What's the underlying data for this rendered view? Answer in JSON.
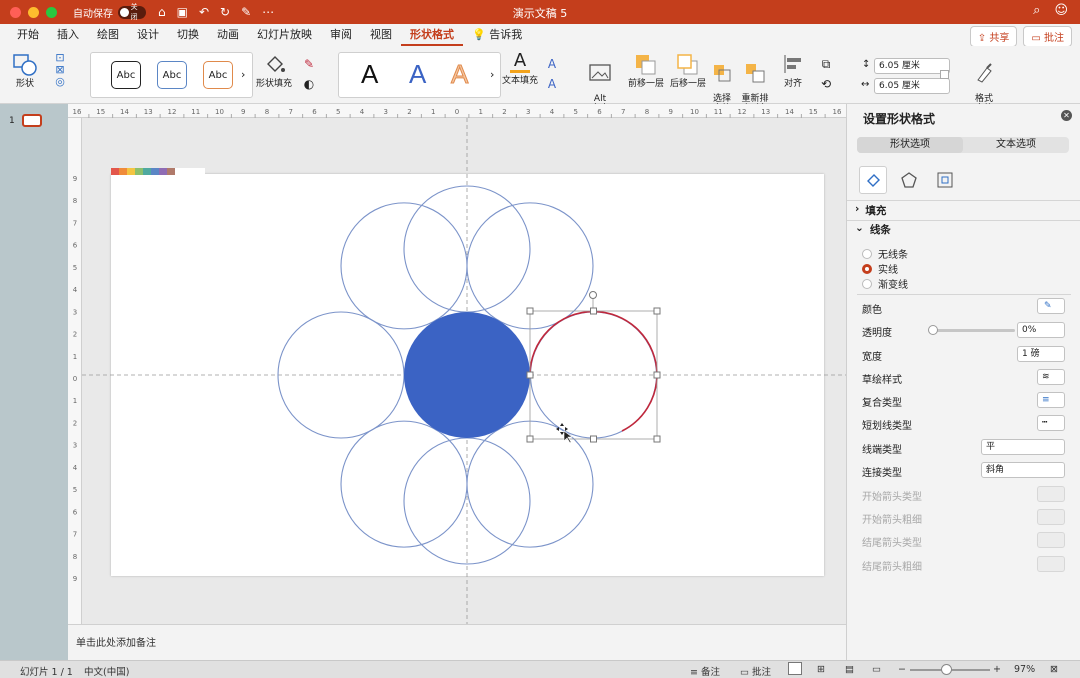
{
  "app": {
    "doc_title": "演示文稿 5",
    "autosave_label": "自动保存",
    "autosave_state": "关闭",
    "titlebar_color": "#c43e1c"
  },
  "tabs": [
    {
      "label": "开始"
    },
    {
      "label": "插入"
    },
    {
      "label": "绘图"
    },
    {
      "label": "设计"
    },
    {
      "label": "切换"
    },
    {
      "label": "动画"
    },
    {
      "label": "幻灯片放映"
    },
    {
      "label": "审阅"
    },
    {
      "label": "视图"
    },
    {
      "label": "形状格式",
      "active": true
    },
    {
      "label": "告诉我"
    }
  ],
  "header_buttons": {
    "share": "共享",
    "comment": "批注"
  },
  "ribbon": {
    "shape_label": "形状",
    "shape_style_samples": [
      "Abc",
      "Abc",
      "Abc"
    ],
    "shape_fill_label": "形状填充",
    "wordart_samples": [
      "A",
      "A",
      "A"
    ],
    "text_fill_label": "文本填充",
    "alt_text_label": "Alt\n文本",
    "bring_forward": "前移一层",
    "send_backward": "后移一层",
    "selection_pane": "选择\n窗格",
    "reorder": "重新排\n序对象",
    "align": "对齐",
    "height": "6.05 厘米",
    "width": "6.05 厘米",
    "format_pane": "格式\n窗格"
  },
  "thumbnail": {
    "number": "1"
  },
  "ruler_labels": [
    "16",
    "15",
    "14",
    "13",
    "12",
    "11",
    "10",
    "9",
    "8",
    "7",
    "6",
    "5",
    "4",
    "3",
    "2",
    "1",
    "0",
    "1",
    "2",
    "3",
    "4",
    "5",
    "6",
    "7",
    "8",
    "9",
    "10",
    "11",
    "12",
    "13",
    "14",
    "15",
    "16"
  ],
  "vruler_labels": [
    "9",
    "8",
    "7",
    "6",
    "5",
    "4",
    "3",
    "2",
    "1",
    "0",
    "1",
    "2",
    "3",
    "4",
    "5",
    "6",
    "7",
    "8",
    "9"
  ],
  "slide": {
    "swatch_colors": [
      "#e3574b",
      "#f08b3a",
      "#f4c542",
      "#8dc06c",
      "#4fa9a0",
      "#5b86c5",
      "#8f6cb4",
      "#b07a6a"
    ],
    "circle_stroke": "#7b93c9",
    "center_fill": "#3b63c4",
    "selected_stroke": "#c0283c"
  },
  "notes_placeholder": "单击此处添加备注",
  "format_pane": {
    "title": "设置形状格式",
    "tabs": [
      "形状选项",
      "文本选项"
    ],
    "fill_section": "填充",
    "line_section": "线条",
    "line_options": [
      {
        "label": "无线条",
        "selected": false
      },
      {
        "label": "实线",
        "selected": true
      },
      {
        "label": "渐变线",
        "selected": false
      }
    ],
    "color_label": "颜色",
    "transparency_label": "透明度",
    "transparency_value": "0%",
    "transparency_level": 0,
    "width_label": "宽度",
    "width_value": "1 磅",
    "sketch_label": "草绘样式",
    "compound_label": "复合类型",
    "dash_label": "短划线类型",
    "cap_label": "线端类型",
    "cap_value": "平",
    "join_label": "连接类型",
    "join_value": "斜角",
    "arrow_start_type": "开始箭头类型",
    "arrow_start_size": "开始箭头粗细",
    "arrow_end_type": "结尾箭头类型",
    "arrow_end_size": "结尾箭头粗细"
  },
  "status": {
    "slide": "幻灯片 1 / 1",
    "language": "中文(中国)",
    "notes": "备注",
    "comments": "批注",
    "zoom": "97%"
  }
}
